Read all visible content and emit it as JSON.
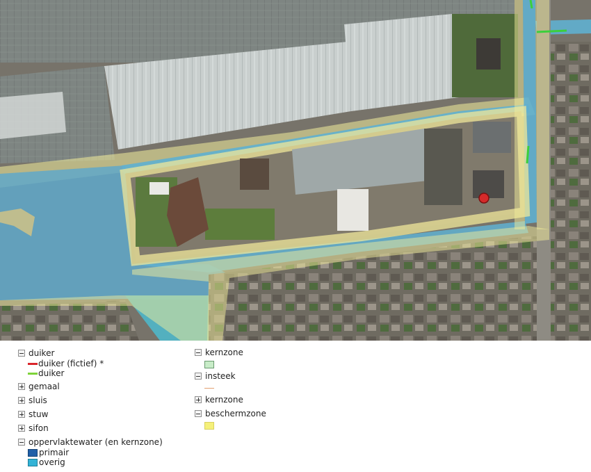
{
  "map": {
    "marker_color": "#d42a2a",
    "water_color": "#5fa8c9",
    "zone_color": "#f2ec9a",
    "culvert_green": "#3ccf3c"
  },
  "legend": {
    "duiker": {
      "label": "duiker",
      "toggle": "-",
      "items": [
        {
          "label": "duiker (fictief) *",
          "color": "#d9262b"
        },
        {
          "label": "duiker",
          "color": "#7ed33a"
        }
      ]
    },
    "gemaal": {
      "label": "gemaal",
      "toggle": "+"
    },
    "sluis": {
      "label": "sluis",
      "toggle": "+"
    },
    "stuw": {
      "label": "stuw",
      "toggle": "+"
    },
    "sifon": {
      "label": "sifon",
      "toggle": "+"
    },
    "oppervlaktewater": {
      "label": "oppervlaktewater (en kernzone)",
      "toggle": "-",
      "items": [
        {
          "label": "primair",
          "color": "#1f5fa8"
        },
        {
          "label": "overig",
          "color": "#33b3d6"
        }
      ]
    },
    "kernzone1": {
      "label": "kernzone",
      "toggle": "-",
      "color": "#c8ecc8"
    },
    "insteek": {
      "label": "insteek",
      "toggle": "-",
      "color": "#e2a070"
    },
    "kernzone2": {
      "label": "kernzone",
      "toggle": "+"
    },
    "beschermzone": {
      "label": "beschermzone",
      "toggle": "-",
      "color": "#f5f07a"
    }
  }
}
